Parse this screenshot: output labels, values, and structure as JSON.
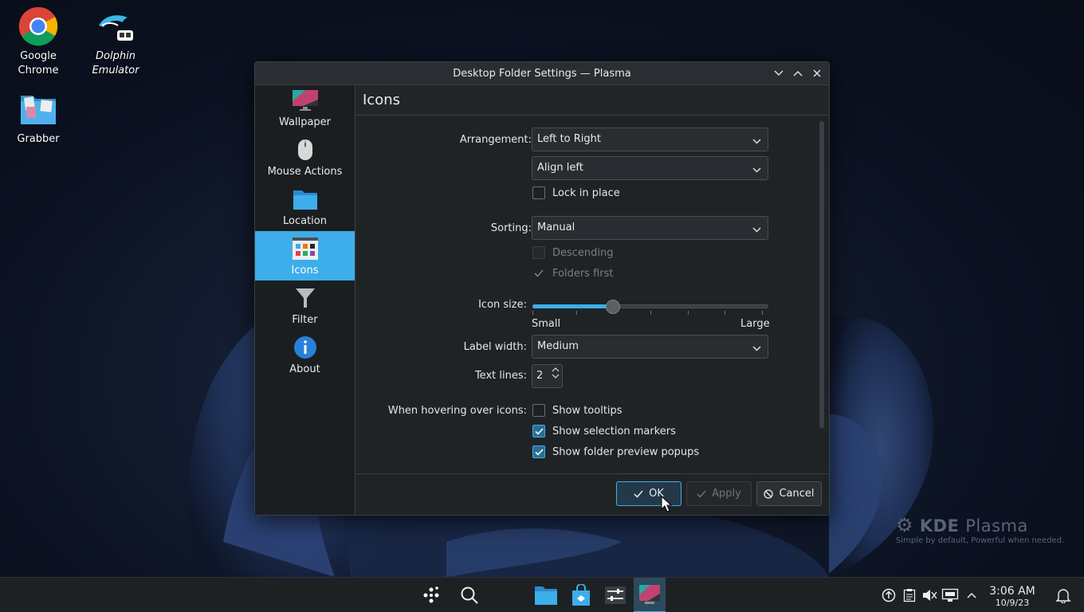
{
  "desktop": {
    "icons": [
      {
        "label": "Google Chrome",
        "line1": "Google",
        "line2": "Chrome"
      },
      {
        "label": "Dolphin Emulator",
        "line1": "Dolphin",
        "line2": "Emulator"
      },
      {
        "label": "Grabber",
        "line1": "Grabber",
        "line2": ""
      }
    ],
    "kde_logo": {
      "name_bold": "KDE",
      "name_light": "Plasma",
      "tagline": "Simple by default, Powerful when needed."
    }
  },
  "dialog": {
    "title": "Desktop Folder Settings — Plasma",
    "sidebar": [
      {
        "label": "Wallpaper",
        "icon": "monitor-icon",
        "active": false
      },
      {
        "label": "Mouse Actions",
        "icon": "mouse-icon",
        "active": false
      },
      {
        "label": "Location",
        "icon": "folder-icon",
        "active": false
      },
      {
        "label": "Icons",
        "icon": "icons-grid-icon",
        "active": true
      },
      {
        "label": "Filter",
        "icon": "funnel-icon",
        "active": false
      },
      {
        "label": "About",
        "icon": "info-icon",
        "active": false
      }
    ],
    "page_title": "Icons",
    "form": {
      "arrangement_label": "Arrangement:",
      "arrangement_value": "Left to Right",
      "alignment_value": "Align left",
      "lock_label": "Lock in place",
      "lock_checked": false,
      "sorting_label": "Sorting:",
      "sorting_value": "Manual",
      "descending_label": "Descending",
      "folders_first_label": "Folders first",
      "icon_size_label": "Icon size:",
      "icon_size_fraction": 0.34,
      "icon_size_min_label": "Small",
      "icon_size_max_label": "Large",
      "label_width_label": "Label width:",
      "label_width_value": "Medium",
      "text_lines_label": "Text lines:",
      "text_lines_value": "2",
      "hover_label": "When hovering over icons:",
      "tooltips_label": "Show tooltips",
      "tooltips_checked": false,
      "selection_markers_label": "Show selection markers",
      "selection_markers_checked": true,
      "preview_popups_label": "Show folder preview popups",
      "preview_popups_checked": true
    },
    "buttons": {
      "ok": "OK",
      "apply": "Apply",
      "cancel": "Cancel"
    }
  },
  "taskbar": {
    "clock_time": "3:06 AM",
    "clock_date": "10/9/23"
  },
  "colors": {
    "accent": "#3daee9",
    "window_bg": "#202326",
    "sidebar_bg": "#1b1e20"
  }
}
